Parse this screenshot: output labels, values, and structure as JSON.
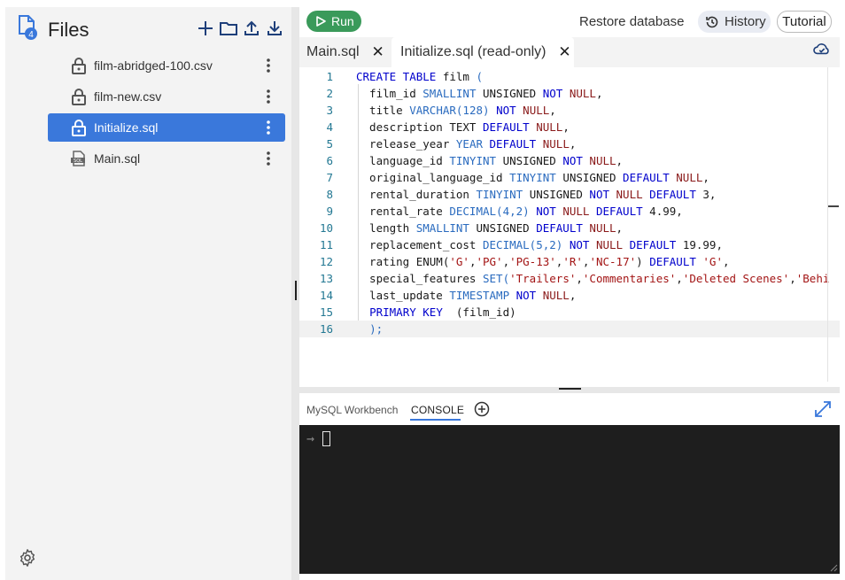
{
  "sidebar": {
    "title": "Files",
    "badge_count": "4",
    "header_actions": [
      "new-file",
      "new-folder",
      "upload",
      "download"
    ],
    "files": [
      {
        "name": "film-abridged-100.csv",
        "icon": "lock-icon",
        "active": false
      },
      {
        "name": "film-new.csv",
        "icon": "lock-icon",
        "active": false
      },
      {
        "name": "Initialize.sql",
        "icon": "lock-icon",
        "active": true
      },
      {
        "name": "Main.sql",
        "icon": "sql-file-icon",
        "active": false
      }
    ],
    "settings_icon": "gear-icon"
  },
  "toolbar": {
    "run_label": "Run",
    "restore_label": "Restore database",
    "history_label": "History",
    "tutorial_label": "Tutorial",
    "accent_color": "#3a9a5a"
  },
  "tabs": [
    {
      "label": "Main.sql",
      "active": false
    },
    {
      "label": "Initialize.sql (read-only)",
      "active": true
    }
  ],
  "editor": {
    "current_line": 16,
    "lines": [
      {
        "n": "1",
        "tokens": [
          [
            "kw",
            "CREATE TABLE "
          ],
          [
            "tx",
            "film "
          ],
          [
            "ty",
            "("
          ]
        ]
      },
      {
        "n": "2",
        "tokens": [
          [
            "tx",
            "  film_id "
          ],
          [
            "ty",
            "SMALLINT "
          ],
          [
            "tx",
            "UNSIGNED "
          ],
          [
            "kw",
            "NOT "
          ],
          [
            "nu",
            "NULL"
          ],
          [
            "tx",
            ","
          ]
        ]
      },
      {
        "n": "3",
        "tokens": [
          [
            "tx",
            "  title "
          ],
          [
            "ty",
            "VARCHAR(128) "
          ],
          [
            "kw",
            "NOT "
          ],
          [
            "nu",
            "NULL"
          ],
          [
            "tx",
            ","
          ]
        ]
      },
      {
        "n": "4",
        "tokens": [
          [
            "tx",
            "  description TEXT "
          ],
          [
            "kw",
            "DEFAULT "
          ],
          [
            "nu",
            "NULL"
          ],
          [
            "tx",
            ","
          ]
        ]
      },
      {
        "n": "5",
        "tokens": [
          [
            "tx",
            "  release_year "
          ],
          [
            "ty",
            "YEAR "
          ],
          [
            "kw",
            "DEFAULT "
          ],
          [
            "nu",
            "NULL"
          ],
          [
            "tx",
            ","
          ]
        ]
      },
      {
        "n": "6",
        "tokens": [
          [
            "tx",
            "  language_id "
          ],
          [
            "ty",
            "TINYINT "
          ],
          [
            "tx",
            "UNSIGNED "
          ],
          [
            "kw",
            "NOT "
          ],
          [
            "nu",
            "NULL"
          ],
          [
            "tx",
            ","
          ]
        ]
      },
      {
        "n": "7",
        "tokens": [
          [
            "tx",
            "  original_language_id "
          ],
          [
            "ty",
            "TINYINT "
          ],
          [
            "tx",
            "UNSIGNED "
          ],
          [
            "kw",
            "DEFAULT "
          ],
          [
            "nu",
            "NULL"
          ],
          [
            "tx",
            ","
          ]
        ]
      },
      {
        "n": "8",
        "tokens": [
          [
            "tx",
            "  rental_duration "
          ],
          [
            "ty",
            "TINYINT "
          ],
          [
            "tx",
            "UNSIGNED "
          ],
          [
            "kw",
            "NOT "
          ],
          [
            "nu",
            "NULL "
          ],
          [
            "kw",
            "DEFAULT "
          ],
          [
            "tx",
            "3,"
          ]
        ]
      },
      {
        "n": "9",
        "tokens": [
          [
            "tx",
            "  rental_rate "
          ],
          [
            "ty",
            "DECIMAL(4,2) "
          ],
          [
            "kw",
            "NOT "
          ],
          [
            "nu",
            "NULL "
          ],
          [
            "kw",
            "DEFAULT "
          ],
          [
            "tx",
            "4.99,"
          ]
        ]
      },
      {
        "n": "10",
        "tokens": [
          [
            "tx",
            "  length "
          ],
          [
            "ty",
            "SMALLINT "
          ],
          [
            "tx",
            "UNSIGNED "
          ],
          [
            "kw",
            "DEFAULT "
          ],
          [
            "nu",
            "NULL"
          ],
          [
            "tx",
            ","
          ]
        ]
      },
      {
        "n": "11",
        "tokens": [
          [
            "tx",
            "  replacement_cost "
          ],
          [
            "ty",
            "DECIMAL(5,2) "
          ],
          [
            "kw",
            "NOT "
          ],
          [
            "nu",
            "NULL "
          ],
          [
            "kw",
            "DEFAULT "
          ],
          [
            "tx",
            "19.99,"
          ]
        ]
      },
      {
        "n": "12",
        "tokens": [
          [
            "tx",
            "  rating ENUM("
          ],
          [
            "st",
            "'G'"
          ],
          [
            "tx",
            ","
          ],
          [
            "st",
            "'PG'"
          ],
          [
            "tx",
            ","
          ],
          [
            "st",
            "'PG-13'"
          ],
          [
            "tx",
            ","
          ],
          [
            "st",
            "'R'"
          ],
          [
            "tx",
            ","
          ],
          [
            "st",
            "'NC-17'"
          ],
          [
            "tx",
            ") "
          ],
          [
            "kw",
            "DEFAULT "
          ],
          [
            "st",
            "'G'"
          ],
          [
            "tx",
            ","
          ]
        ]
      },
      {
        "n": "13",
        "tokens": [
          [
            "tx",
            "  special_features "
          ],
          [
            "ty",
            "SET("
          ],
          [
            "st",
            "'Trailers'"
          ],
          [
            "tx",
            ","
          ],
          [
            "st",
            "'Commentaries'"
          ],
          [
            "tx",
            ","
          ],
          [
            "st",
            "'Deleted Scenes'"
          ],
          [
            "tx",
            ","
          ],
          [
            "st",
            "'Behi"
          ]
        ]
      },
      {
        "n": "14",
        "tokens": [
          [
            "tx",
            "  last_update "
          ],
          [
            "ty",
            "TIMESTAMP "
          ],
          [
            "kw",
            "NOT "
          ],
          [
            "nu",
            "NULL"
          ],
          [
            "tx",
            ","
          ]
        ]
      },
      {
        "n": "15",
        "tokens": [
          [
            "tx",
            "  "
          ],
          [
            "kw",
            "PRIMARY KEY "
          ],
          [
            "tx",
            " (film_id)"
          ]
        ]
      },
      {
        "n": "16",
        "tokens": [
          [
            "tx",
            "  "
          ],
          [
            "ty",
            ");"
          ]
        ]
      }
    ]
  },
  "panel": {
    "tab_workbench": "MySQL Workbench",
    "tab_console": "CONSOLE",
    "prompt_glyph": "→"
  }
}
